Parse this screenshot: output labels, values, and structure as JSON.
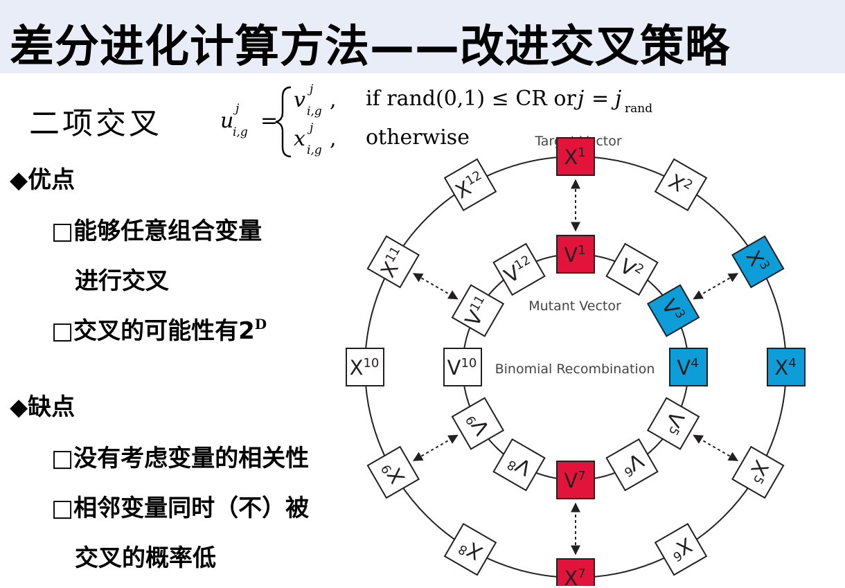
{
  "title": "差分进化计算方法——改进交叉策略",
  "binomial": {
    "heading": "二项交叉",
    "formula": {
      "lhs_base": "u",
      "lhs_sub": "i,g",
      "lhs_sup": "j",
      "equals": "=",
      "case1_base": "v",
      "case1_sub": "i,g",
      "case1_sup": "j",
      "case1_comma": ",",
      "case1_condition": "if rand(0,1) ≤ CR or",
      "case1_j": "j",
      "case1_eq": "=",
      "case1_jrand_base": "j",
      "case1_jrand_sub": "rand",
      "case2_base": "x",
      "case2_sub": "i,g",
      "case2_sup": "j",
      "case2_comma": ",",
      "case2_condition": "otherwise"
    }
  },
  "advantages": {
    "heading": "◆优点",
    "items": [
      {
        "bullet": "□",
        "line1": "能够任意组合变量",
        "line2": "进行交叉"
      },
      {
        "bullet": "□",
        "text": "交叉的可能性有2",
        "sup": "D"
      }
    ]
  },
  "disadvantages": {
    "heading": "◆缺点",
    "items": [
      {
        "bullet": "□",
        "text": "没有考虑变量的相关性"
      },
      {
        "bullet": "□",
        "line1": "相邻变量同时（不）被",
        "line2": "交叉的概率低"
      }
    ]
  },
  "diagram": {
    "target_label": "Target Vector",
    "mutant_label": "Mutant Vector",
    "center_label": "Binomial Recombination",
    "colors": {
      "red": "#e3143c",
      "blue": "#0d9ed9",
      "white": "#ffffff",
      "stroke": "#231f20"
    },
    "outer": [
      {
        "base": "X",
        "sup": "1",
        "color": "red"
      },
      {
        "base": "X",
        "sup": "2",
        "color": "white"
      },
      {
        "base": "X",
        "sup": "3",
        "color": "blue"
      },
      {
        "base": "X",
        "sup": "4",
        "color": "blue"
      },
      {
        "base": "X",
        "sup": "5",
        "color": "white"
      },
      {
        "base": "X",
        "sup": "6",
        "color": "white"
      },
      {
        "base": "X",
        "sup": "7",
        "color": "red"
      },
      {
        "base": "X",
        "sup": "8",
        "color": "white"
      },
      {
        "base": "X",
        "sup": "9",
        "color": "white"
      },
      {
        "base": "X",
        "sup": "10",
        "color": "white"
      },
      {
        "base": "X",
        "sup": "11",
        "color": "white"
      },
      {
        "base": "X",
        "sup": "12",
        "color": "white"
      }
    ],
    "inner": [
      {
        "base": "V",
        "sup": "1",
        "color": "red"
      },
      {
        "base": "V",
        "sup": "2",
        "color": "white"
      },
      {
        "base": "V",
        "sup": "3",
        "color": "blue"
      },
      {
        "base": "V",
        "sup": "4",
        "color": "blue"
      },
      {
        "base": "V",
        "sup": "5",
        "color": "white"
      },
      {
        "base": "V",
        "sup": "6",
        "color": "white"
      },
      {
        "base": "V",
        "sup": "7",
        "color": "red"
      },
      {
        "base": "V",
        "sup": "8",
        "color": "white"
      },
      {
        "base": "V",
        "sup": "9",
        "color": "white"
      },
      {
        "base": "V",
        "sup": "10",
        "color": "white"
      },
      {
        "base": "V",
        "sup": "11",
        "color": "white"
      },
      {
        "base": "V",
        "sup": "12",
        "color": "white"
      }
    ],
    "links": [
      1,
      3,
      5,
      7,
      9,
      11
    ]
  }
}
